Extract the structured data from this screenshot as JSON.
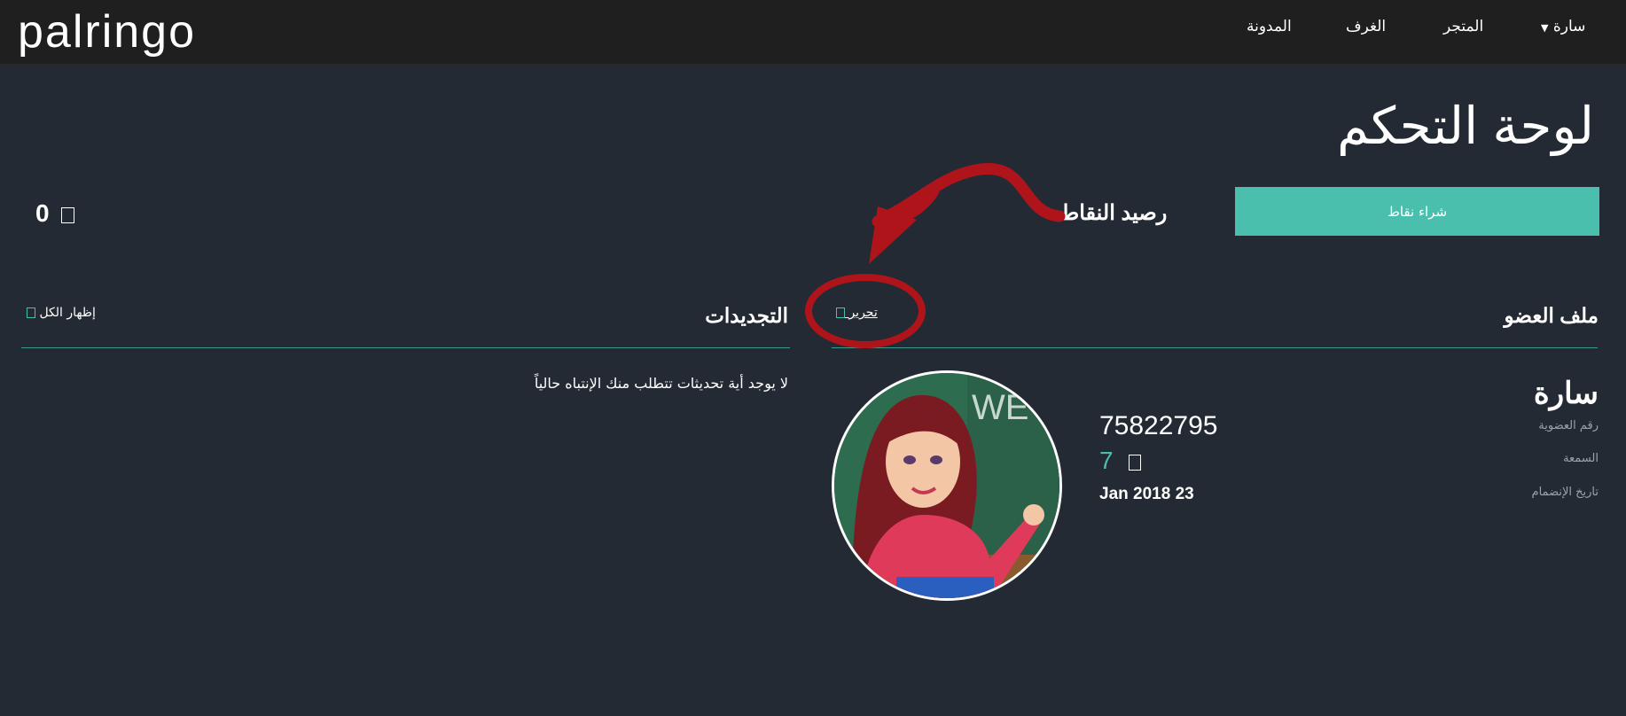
{
  "brand": {
    "logo_text": "palringo"
  },
  "nav": {
    "user_label": "سارة",
    "store_label": "المتجر",
    "rooms_label": "الغرف",
    "blog_label": "المدونة"
  },
  "page": {
    "title": "لوحة التحكم"
  },
  "credits": {
    "buy_button_label": "شراء نقاط",
    "points_value": "0",
    "annotation_label": "رصيد النقاط"
  },
  "profile": {
    "heading": "ملف العضو",
    "edit_link": "تحرير",
    "name": "سارة",
    "fields": {
      "member_id_label": "رقم العضوية",
      "member_id_value": "75822795",
      "reputation_label": "السمعة",
      "reputation_value": "7",
      "join_date_label": "تاريخ الإنضمام",
      "join_date_value": "Jan 2018 23"
    }
  },
  "updates": {
    "heading": "التجديدات",
    "show_all_link": "إظهار الكل",
    "empty_message": "لا يوجد أية تحديثات تتطلب منك الإنتباه حالياً"
  },
  "colors": {
    "accent": "#4bbfae",
    "background": "#232a33",
    "topbar": "#1f1f1f",
    "annotation_red": "#b0141b"
  },
  "icons": {
    "user_dropdown": "caret-down-icon",
    "points": "square-icon",
    "edit": "square-icon",
    "show_all": "square-icon"
  }
}
